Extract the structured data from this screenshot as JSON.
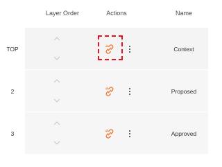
{
  "header": {
    "layer_order": "Layer Order",
    "actions": "Actions",
    "name": "Name"
  },
  "rows": [
    {
      "order": "TOP",
      "name": "Context"
    },
    {
      "order": "2",
      "name": "Proposed"
    },
    {
      "order": "3",
      "name": "Approved"
    }
  ],
  "icons": {
    "link": "unlink-icon",
    "menu": "more-vert-icon",
    "up": "chevron-up-icon",
    "down": "chevron-down-icon"
  },
  "colors": {
    "accent": "#f07b3a",
    "highlight": "#e8101c",
    "row_background": "#f6f6f6",
    "chevron": "#c7c7c7"
  }
}
